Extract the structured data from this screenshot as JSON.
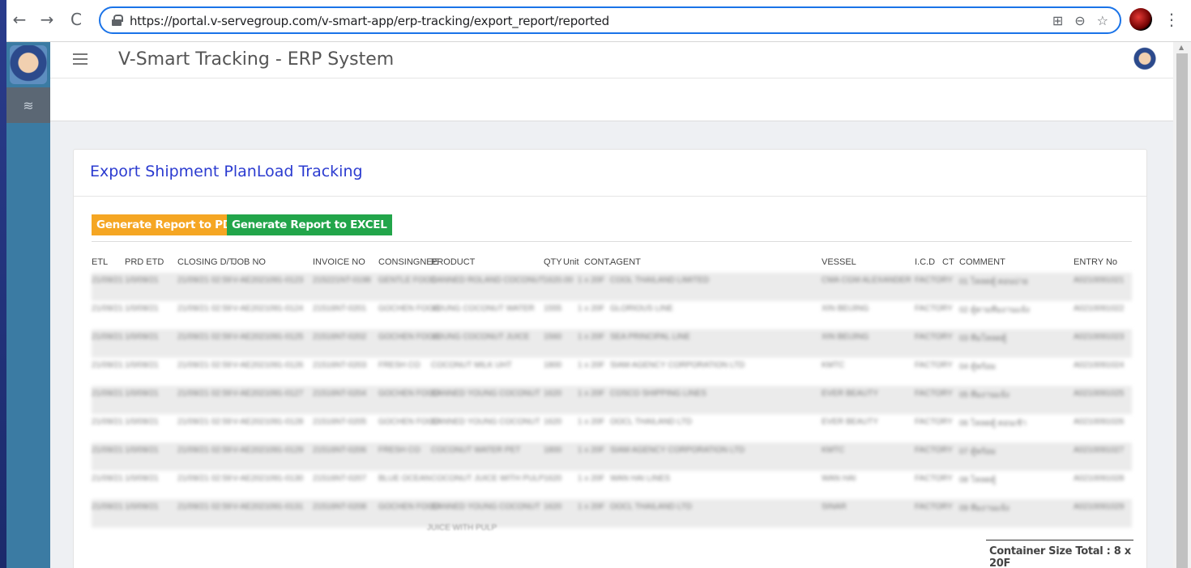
{
  "browser": {
    "url": "https://portal.v-servegroup.com/v-smart-app/erp-tracking/export_report/reported",
    "back_icon": "←",
    "forward_icon": "→",
    "reload_icon": "C",
    "menu_icon": "⋮",
    "url_icons": [
      "⊞",
      "⊖",
      "☆"
    ]
  },
  "app": {
    "title": "V-Smart Tracking - ERP System",
    "sidebar_icon": "≋"
  },
  "card": {
    "title": "Export Shipment PlanLoad Tracking",
    "btn_pdf": "Generate Report to PDF",
    "btn_excel": "Generate Report to EXCEL"
  },
  "table": {
    "headers": [
      "ETL",
      "PRD ETD",
      "CLOSING D/T",
      "JOB NO",
      "INVOICE NO",
      "CONSINGNEE",
      "PRODUCT",
      "QTY",
      "Unit",
      "CONT.",
      "AGENT",
      "VESSEL",
      "I.C.D",
      "CT",
      "COMMENT",
      "ENTRY No"
    ],
    "rows": [
      {
        "etl": "21/09/21",
        "prd": "1/0/09/21",
        "closing": "21/09/21 02:59",
        "job": "V-AE2021091-0123",
        "invoice": "215221NT-0198",
        "consignee": "GENTLE FOOD",
        "product": "CANNED ROLAND COCONUT",
        "qty": "1620.00",
        "cont": "1 x 20F",
        "agent": "COOL THAILAND LIMITED",
        "vessel": "CMA CGM ALEXANDER",
        "icd": "FACTORY",
        "comment": "01 โหลดตู้ ตอนบ่าย",
        "entry": "A0210091021"
      },
      {
        "etl": "21/09/21",
        "prd": "1/0/09/21",
        "closing": "21/09/21 02:59",
        "job": "V-AE2021091-0124",
        "invoice": "21516NT-0201",
        "consignee": "GOCHEN FOOD",
        "product": "YOUNG COCONUT WATER",
        "qty": "1555",
        "cont": "1 x 20F",
        "agent": "GLORIOUS LINE",
        "vessel": "XIN BEIJING",
        "icd": "FACTORY",
        "comment": "02 ตู้ตามทีมงานแจ้ง",
        "entry": "A0210091022"
      },
      {
        "etl": "21/09/21",
        "prd": "1/0/09/21",
        "closing": "21/09/21 02:59",
        "job": "V-AE2021091-0125",
        "invoice": "21516NT-0202",
        "consignee": "GOCHEN FOOD",
        "product": "YOUNG COCONUT JUICE",
        "qty": "1560",
        "cont": "1 x 20F",
        "agent": "SEA PRINCIPAL LINE",
        "vessel": "XIN BEIJING",
        "icd": "FACTORY",
        "comment": "03 ทีมโหลดตู้",
        "entry": "A0210091023"
      },
      {
        "etl": "21/09/21",
        "prd": "1/0/09/21",
        "closing": "21/09/21 02:59",
        "job": "V-AE2021091-0126",
        "invoice": "21516NT-0203",
        "consignee": "FRESH CO",
        "product": "COCONUT MILK UHT",
        "qty": "1800",
        "cont": "1 x 20F",
        "agent": "SIAM AGENCY CORPORATION LTD",
        "vessel": "KMTC",
        "icd": "FACTORY",
        "comment": "04 ตู้พร้อม",
        "entry": "A0210091024"
      },
      {
        "etl": "21/09/21",
        "prd": "1/0/09/21",
        "closing": "21/09/21 02:59",
        "job": "V-AE2021091-0127",
        "invoice": "21516NT-0204",
        "consignee": "GOCHEN FOOD",
        "product": "CANNED YOUNG COCONUT",
        "qty": "1620",
        "cont": "1 x 20F",
        "agent": "COSCO SHIPPING LINES",
        "vessel": "EVER BEAUTY",
        "icd": "FACTORY",
        "comment": "05 ทีมงานแจ้ง",
        "entry": "A0210091025"
      },
      {
        "etl": "21/09/21",
        "prd": "1/0/09/21",
        "closing": "21/09/21 02:59",
        "job": "V-AE2021091-0128",
        "invoice": "21516NT-0205",
        "consignee": "GOCHEN FOOD",
        "product": "CANNED YOUNG COCONUT",
        "qty": "1620",
        "cont": "1 x 20F",
        "agent": "OOCL THAILAND LTD",
        "vessel": "EVER BEAUTY",
        "icd": "FACTORY",
        "comment": "06 โหลดตู้ ตอนเช้า",
        "entry": "A0210091026"
      },
      {
        "etl": "21/09/21",
        "prd": "1/0/09/21",
        "closing": "21/09/21 02:59",
        "job": "V-AE2021091-0129",
        "invoice": "21516NT-0206",
        "consignee": "FRESH CO",
        "product": "COCONUT WATER PET",
        "qty": "1800",
        "cont": "1 x 20F",
        "agent": "SIAM AGENCY CORPORATION LTD",
        "vessel": "KMTC",
        "icd": "FACTORY",
        "comment": "07 ตู้พร้อม",
        "entry": "A0210091027"
      },
      {
        "etl": "21/09/21",
        "prd": "1/0/09/21",
        "closing": "21/09/21 02:59",
        "job": "V-AE2021091-0130",
        "invoice": "21516NT-0207",
        "consignee": "BLUE OCEAN",
        "product": "COCONUT JUICE WITH PULP",
        "qty": "1620",
        "cont": "1 x 20F",
        "agent": "WAN HAI LINES",
        "vessel": "WAN HAI",
        "icd": "FACTORY",
        "comment": "08 โหลดตู้",
        "entry": "A0210091028"
      },
      {
        "etl": "21/09/21",
        "prd": "1/0/09/21",
        "closing": "21/09/21 02:59",
        "job": "V-AE2021091-0131",
        "invoice": "21516NT-0208",
        "consignee": "GOCHEN FOOD",
        "product": "CANNED YOUNG COCONUT",
        "qty": "1620",
        "cont": "1 x 20F",
        "agent": "OOCL THAILAND LTD",
        "vessel": "SINAR",
        "icd": "FACTORY",
        "comment": "09 ทีมงานแจ้ง",
        "entry": "A0210091029"
      }
    ],
    "row_tail": "JUICE WITH PULP"
  },
  "footer": {
    "total": "Container Size Total : 8 x 20F"
  }
}
